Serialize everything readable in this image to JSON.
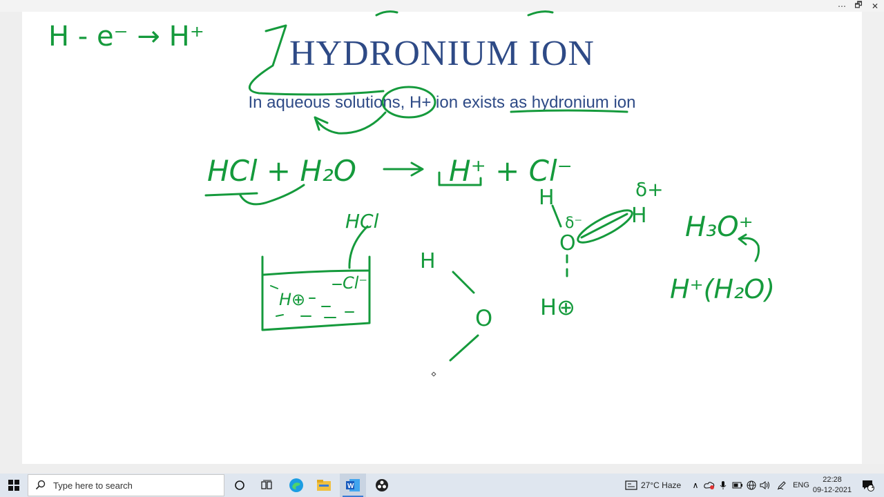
{
  "window": {
    "more_icon": "⋯",
    "restore_icon": "🗗",
    "close_icon": "✕"
  },
  "slide": {
    "title": "HYDRONIUM ION",
    "subtitle": "In aqueous solutions, H+ ion exists as hydronium ion"
  },
  "ink": {
    "top_equation": "H - e⁻ → H⁺",
    "reaction_lhs": "HCl + H₂O",
    "reaction_rhs": "H⁺ + Cl⁻",
    "beaker_label": "HCl",
    "beaker_h": "H⊕",
    "beaker_cl": "Cl⁻",
    "water_h": "H",
    "water_o": "O",
    "dipole_h_left": "H",
    "dipole_delta_minus": "δ⁻",
    "dipole_o": "O",
    "dipole_h_right": "H",
    "dipole_delta_plus": "δ+",
    "dipole_h_plus": "H⊕",
    "hydronium_formula": "H₃O⁺",
    "hydronium_alt": "H⁺(H₂O)"
  },
  "taskbar": {
    "search_placeholder": "Type here to search",
    "weather": "27°C  Haze",
    "language": "ENG",
    "time": "22:28",
    "date": "09-12-2021",
    "notification_count": "1",
    "apps": [
      "start-icon",
      "search-icon",
      "cortana-icon",
      "task-view-icon",
      "edge-icon",
      "file-explorer-icon",
      "word-icon",
      "obs-icon"
    ]
  }
}
